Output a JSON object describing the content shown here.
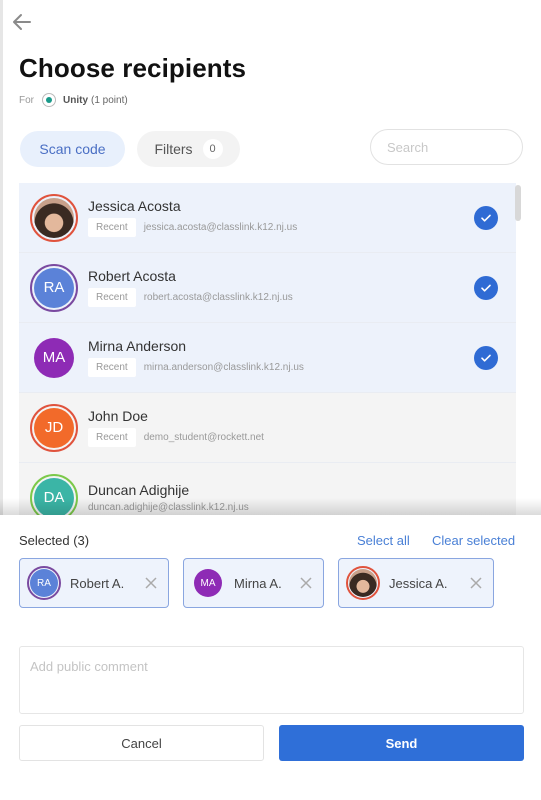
{
  "header": {
    "title": "Choose recipients",
    "for_label": "For",
    "assignment_name": "Unity",
    "assignment_points": "(1 point)"
  },
  "toolbar": {
    "scan_code_label": "Scan code",
    "filters_label": "Filters",
    "filters_count": "0",
    "search_placeholder": "Search",
    "search_value": ""
  },
  "recipients": [
    {
      "name": "Jessica Acosta",
      "tag": "Recent",
      "email": "jessica.acosta@classlink.k12.nj.us",
      "initials": "",
      "avatar": "photo",
      "avatar_color": "",
      "ring_color": "#e0533d",
      "selected": true
    },
    {
      "name": "Robert Acosta",
      "tag": "Recent",
      "email": "robert.acosta@classlink.k12.nj.us",
      "initials": "RA",
      "avatar": "initials",
      "avatar_color": "#5b82d8",
      "ring_color": "#7a4aa0",
      "selected": true
    },
    {
      "name": "Mirna Anderson",
      "tag": "Recent",
      "email": "mirna.anderson@classlink.k12.nj.us",
      "initials": "MA",
      "avatar": "initials",
      "avatar_color": "#8e2bb5",
      "ring_color": "",
      "selected": true
    },
    {
      "name": "John Doe",
      "tag": "Recent",
      "email": "demo_student@rockett.net",
      "initials": "JD",
      "avatar": "initials",
      "avatar_color": "#f26a2a",
      "ring_color": "#e0533d",
      "selected": false
    },
    {
      "name": "Duncan Adighije",
      "tag": "",
      "email": "duncan.adighije@classlink.k12.nj.us",
      "initials": "DA",
      "avatar": "initials",
      "avatar_color": "#3bb5a6",
      "ring_color": "#7cc94a",
      "selected": false
    }
  ],
  "selection": {
    "title": "Selected (3)",
    "select_all_label": "Select all",
    "clear_selected_label": "Clear selected",
    "chips": [
      {
        "label": "Robert A.",
        "initials": "RA"
      },
      {
        "label": "Mirna A.",
        "initials": "MA"
      },
      {
        "label": "Jessica A.",
        "initials": ""
      }
    ]
  },
  "comment": {
    "placeholder": "Add public comment",
    "value": ""
  },
  "actions": {
    "cancel_label": "Cancel",
    "send_label": "Send"
  },
  "colors": {
    "accent": "#2f6fd8",
    "selected_row_bg": "#edf2fb",
    "link": "#4a80d6"
  }
}
